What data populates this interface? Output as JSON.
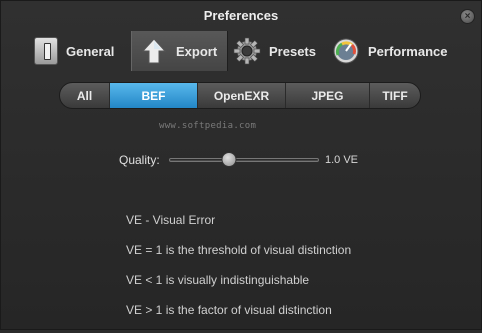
{
  "window": {
    "title": "Preferences"
  },
  "toolbar": {
    "items": [
      {
        "label": "General",
        "icon": "switch-icon",
        "active": false
      },
      {
        "label": "Export",
        "icon": "export-arrow-icon",
        "active": true
      },
      {
        "label": "Presets",
        "icon": "gear-icon",
        "active": false
      },
      {
        "label": "Performance",
        "icon": "gauge-icon",
        "active": false
      }
    ]
  },
  "format_tabs": {
    "items": [
      "All",
      "BEF",
      "OpenEXR",
      "JPEG",
      "TIFF"
    ],
    "selected": "BEF"
  },
  "watermark": "www.softpedia.com",
  "quality": {
    "label": "Quality:",
    "value_text": "1.0 VE",
    "level": 0.4
  },
  "info": {
    "lines": [
      "VE - Visual Error",
      "VE = 1 is the threshold of visual distinction",
      "VE < 1 is visually indistinguishable",
      "VE > 1 is the factor of visual distinction"
    ]
  },
  "colors": {
    "accent": "#2e95d3",
    "background": "#2b2b2b"
  }
}
